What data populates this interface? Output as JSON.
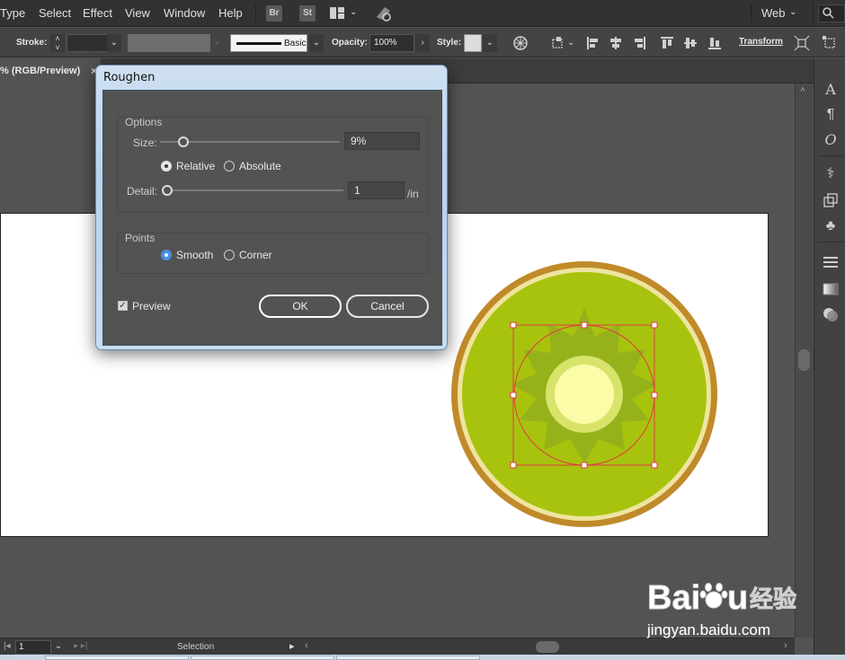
{
  "menu": {
    "items": [
      "Type",
      "Select",
      "Effect",
      "View",
      "Window",
      "Help"
    ],
    "br_label": "Br",
    "st_label": "St",
    "workspace": "Web",
    "search_placeholder": ""
  },
  "control": {
    "stroke_label": "Stroke:",
    "brush_label": "Basic",
    "opacity_label": "Opacity:",
    "opacity_value": "100%",
    "style_label": "Style:",
    "transform_label": "Transform"
  },
  "document": {
    "tab_label": "% (RGB/Preview)",
    "tab_close": "×"
  },
  "dialog": {
    "title": "Roughen",
    "options_title": "Options",
    "size_label": "Size:",
    "size_value": "9%",
    "size_fraction": 0.09,
    "relative_label": "Relative",
    "absolute_label": "Absolute",
    "size_mode": "Relative",
    "detail_label": "Detail:",
    "detail_value": "1",
    "detail_unit": "/in",
    "points_title": "Points",
    "smooth_label": "Smooth",
    "corner_label": "Corner",
    "points_mode": "Smooth",
    "preview_label": "Preview",
    "preview_checked": true,
    "ok_label": "OK",
    "cancel_label": "Cancel"
  },
  "status": {
    "page_number": "1",
    "tool_label": "Selection"
  },
  "watermark": {
    "brand": "Bai du 经验",
    "url": "jingyan.baidu.com"
  },
  "colors": {
    "kiwi_outer_rim": "#c08a2a",
    "kiwi_inner_rim": "#efe4a0",
    "kiwi_flesh": "#a8c30e",
    "kiwi_star": "#96b21a",
    "kiwi_ring": "#d7e36a",
    "kiwi_core": "#fbfba8",
    "selection": "#e53945",
    "radio_on": "#4a90e2"
  }
}
